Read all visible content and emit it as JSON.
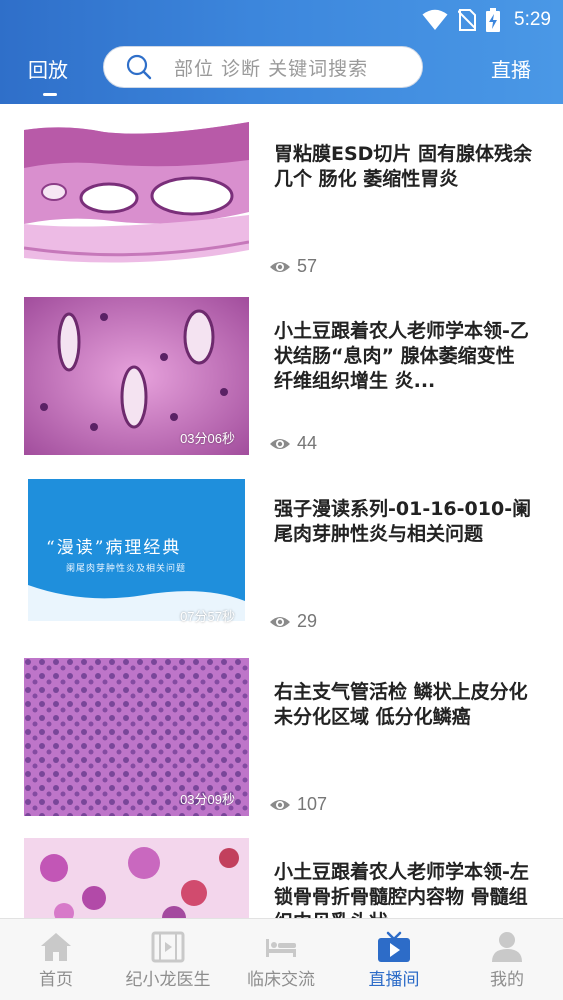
{
  "status_bar": {
    "time": "5:29"
  },
  "header": {
    "tab_replay": "回放",
    "search_placeholder": "部位 诊断 关键词搜索",
    "tab_live": "直播"
  },
  "videos": [
    {
      "title": "胃粘膜ESD切片  固有腺体残余几个  肠化  萎缩性胃炎",
      "views": "57",
      "duration": ""
    },
    {
      "title": "小土豆跟着农人老师学本领-乙状结肠“息肉” 腺体萎缩变性 纤维组织增生 炎...",
      "views": "44",
      "duration": "03分06秒"
    },
    {
      "title": "强子漫读系列-01-16-010-阑尾肉芽肿性炎与相关问题",
      "views": "29",
      "duration": "07分57秒",
      "thumb_heading": "“漫读”病理经典",
      "thumb_subheading": "阑尾肉芽肿性炎及相关问题"
    },
    {
      "title": "右主支气管活检  鳞状上皮分化  未分化区域  低分化鳞癌",
      "views": "107",
      "duration": "03分09秒"
    },
    {
      "title": "小土豆跟着农人老师学本领-左锁骨骨折骨髓腔内容物  骨髓组织中见乳头状...",
      "views": "",
      "duration": ""
    }
  ],
  "bottom_nav": {
    "items": [
      {
        "label": "首页",
        "icon": "home-icon"
      },
      {
        "label": "纪小龙医生",
        "icon": "film-icon"
      },
      {
        "label": "临床交流",
        "icon": "bed-icon"
      },
      {
        "label": "直播间",
        "icon": "tv-play-icon",
        "active": true
      },
      {
        "label": "我的",
        "icon": "person-icon"
      }
    ]
  },
  "colors": {
    "primary": "#2f6fc9",
    "active_nav": "#2d6cc8"
  }
}
